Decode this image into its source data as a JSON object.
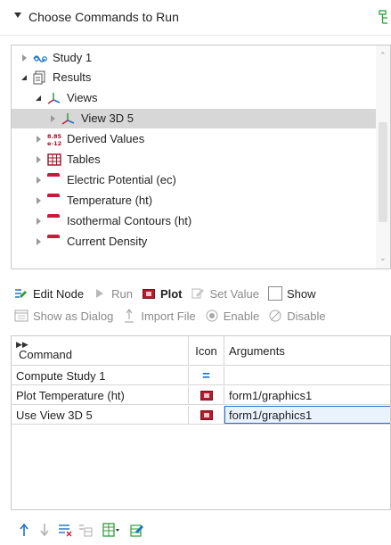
{
  "header": {
    "title": "Choose Commands to Run"
  },
  "tree": {
    "items": [
      {
        "label": "Study 1",
        "icon": "study-icon",
        "expanded": false
      },
      {
        "label": "Results",
        "icon": "results-icon",
        "expanded": true
      },
      {
        "label": "Views",
        "icon": "views-icon",
        "expanded": true
      },
      {
        "label": "View 3D 5",
        "icon": "view3d-icon",
        "expanded": false,
        "selected": true
      },
      {
        "label": "Derived Values",
        "icon": "derived-values-icon",
        "expanded": false
      },
      {
        "label": "Tables",
        "icon": "tables-icon",
        "expanded": false
      },
      {
        "label": "Electric Potential (ec)",
        "icon": "plot-group-icon",
        "expanded": false
      },
      {
        "label": "Temperature (ht)",
        "icon": "plot-group-icon",
        "expanded": false
      },
      {
        "label": "Isothermal Contours (ht)",
        "icon": "plot-group-icon",
        "expanded": false
      },
      {
        "label": "Current Density",
        "icon": "plot-group-icon",
        "expanded": false
      }
    ]
  },
  "toolbar1": {
    "edit_node": "Edit Node",
    "run": "Run",
    "plot": "Plot",
    "set_value": "Set Value",
    "show": "Show"
  },
  "toolbar2": {
    "show_as_dialog": "Show as Dialog",
    "import_file": "Import File",
    "enable": "Enable",
    "disable": "Disable"
  },
  "table": {
    "headers": {
      "command": "Command",
      "icon": "Icon",
      "arguments": "Arguments"
    },
    "rows": [
      {
        "command": "Compute Study 1",
        "icon": "compute-icon",
        "arguments": ""
      },
      {
        "command": "Plot Temperature (ht)",
        "icon": "plot-icon",
        "arguments": "form1/graphics1"
      },
      {
        "command": "Use View 3D 5",
        "icon": "plot-icon",
        "arguments": "form1/graphics1"
      }
    ]
  },
  "colors": {
    "selection": "#d7d7d7",
    "plot_group": "#a01028",
    "accent_blue": "#1a73c9",
    "accent_green": "#2e9e3a"
  }
}
